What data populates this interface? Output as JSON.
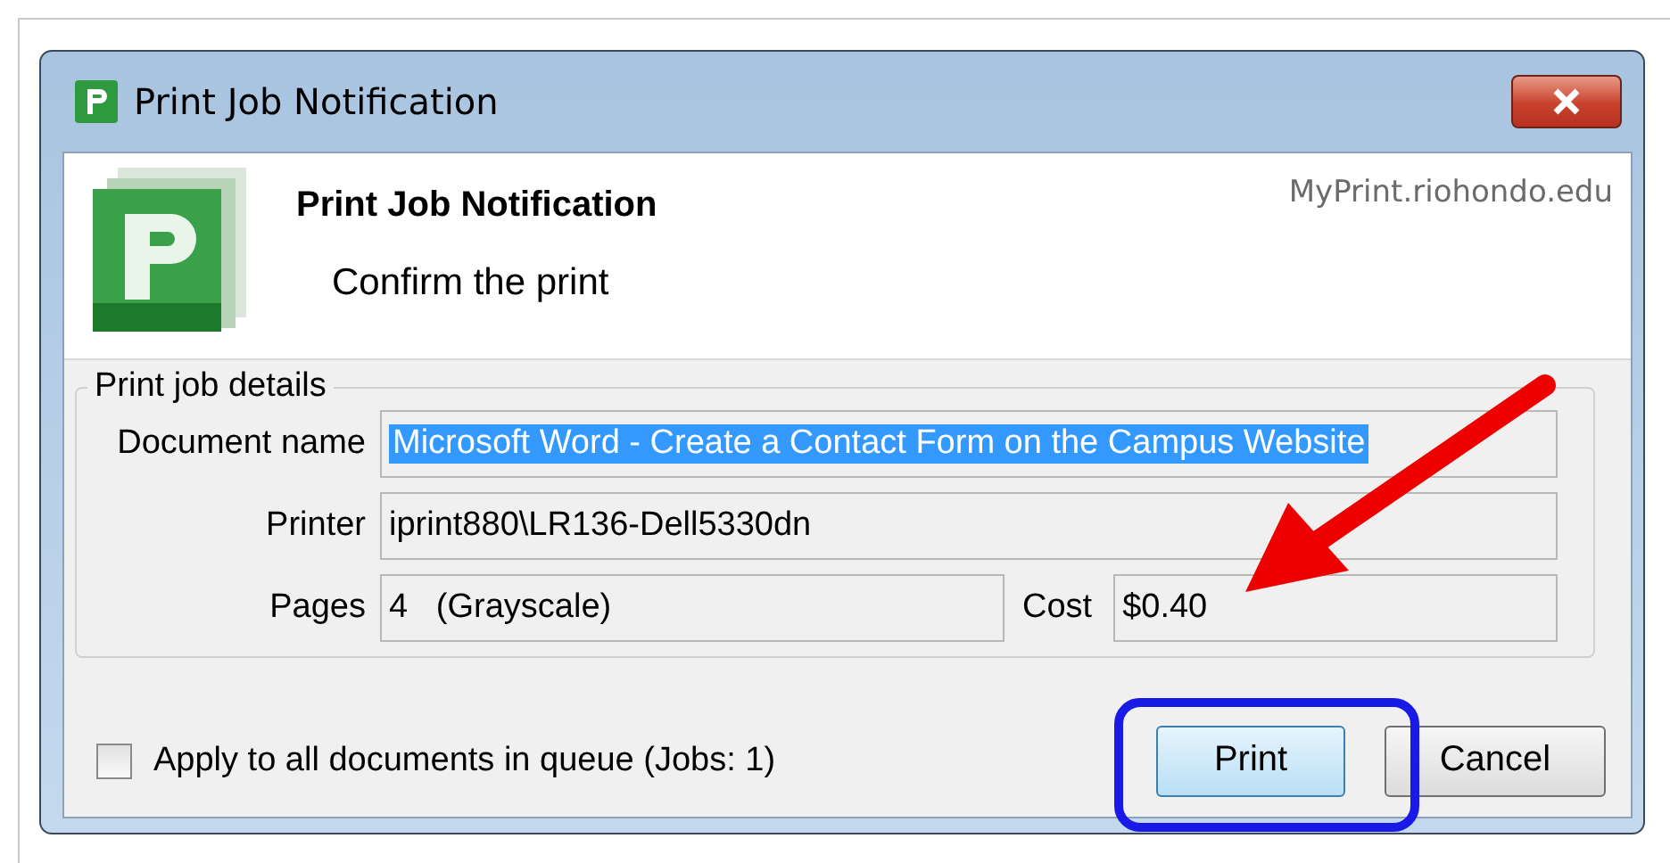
{
  "window": {
    "title": "Print Job Notification"
  },
  "header": {
    "title": "Print Job Notification",
    "subtitle": "Confirm the print",
    "server": "MyPrint.riohondo.edu"
  },
  "group": {
    "legend": "Print job details",
    "fields": [
      {
        "label": "Document name",
        "value": "Microsoft Word - Create a Contact Form on the Campus Website",
        "selected": true
      },
      {
        "label": "Printer",
        "value": "iprint880\\LR136-Dell5330dn",
        "selected": false
      }
    ],
    "pages": {
      "label": "Pages",
      "value": "4   (Grayscale)"
    },
    "cost": {
      "label": "Cost",
      "value": "$0.40"
    }
  },
  "apply_all": {
    "label": "Apply to all documents in queue (Jobs: 1)",
    "checked": false
  },
  "buttons": [
    {
      "label": "Print",
      "highlighted": true
    },
    {
      "label": "Cancel",
      "highlighted": false
    }
  ]
}
